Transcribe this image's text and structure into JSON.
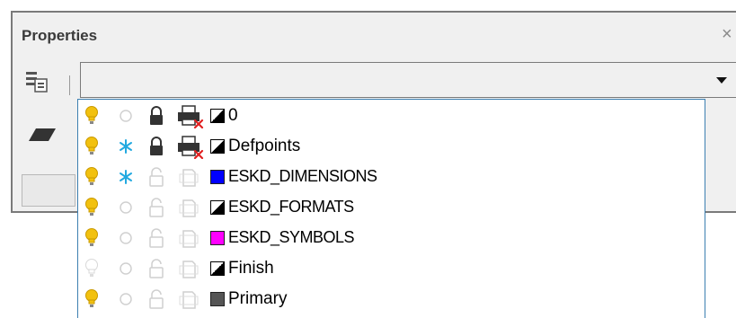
{
  "panel": {
    "title": "Properties",
    "close_glyph": "×",
    "toolbar_icon": "layer-properties-icon",
    "combo_value": ""
  },
  "colors": {
    "bulb_on": "#f2c10f",
    "bulb_off": "#d8d8d8",
    "freeze_on": "#22a9e0",
    "blue": "#0000ff",
    "magenta": "#ff00ff",
    "gray": "#555555"
  },
  "layers": [
    {
      "name": "0",
      "on": true,
      "frozen": false,
      "locked": true,
      "plot": false,
      "color": "bw"
    },
    {
      "name": "Defpoints",
      "on": true,
      "frozen": true,
      "locked": true,
      "plot": false,
      "color": "bw"
    },
    {
      "name": "ESKD_DIMENSIONS",
      "on": true,
      "frozen": true,
      "locked": false,
      "plot": true,
      "color": "#0000ff"
    },
    {
      "name": "ESKD_FORMATS",
      "on": true,
      "frozen": false,
      "locked": false,
      "plot": true,
      "color": "bw"
    },
    {
      "name": "ESKD_SYMBOLS",
      "on": true,
      "frozen": false,
      "locked": false,
      "plot": true,
      "color": "#ff00ff"
    },
    {
      "name": "Finish",
      "on": false,
      "frozen": false,
      "locked": false,
      "plot": true,
      "color": "bw"
    },
    {
      "name": "Primary",
      "on": true,
      "frozen": false,
      "locked": false,
      "plot": true,
      "color": "#555555"
    }
  ]
}
